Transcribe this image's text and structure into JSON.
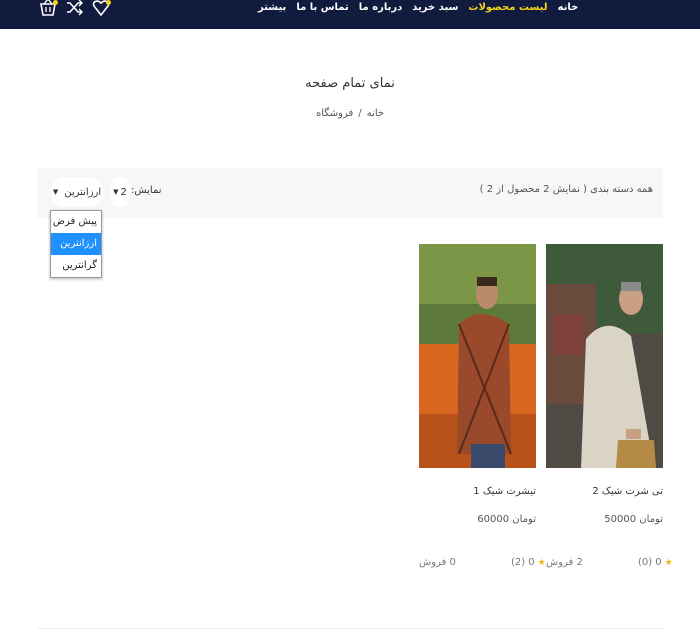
{
  "header": {
    "nav": [
      "خانه",
      "لیست محصولات",
      "سبد خرید",
      "درباره ما",
      "تماس با ما",
      "بیشتر"
    ],
    "active_index": 1,
    "bg_color": "#101b3d",
    "accent_color": "#f3d31b",
    "icons": [
      "basket-icon",
      "shuffle-icon",
      "heart-icon"
    ]
  },
  "page": {
    "title": "نمای تمام صفحه",
    "breadcrumb": [
      "خانه",
      "/",
      "فروشگاه"
    ]
  },
  "toolbar": {
    "result_text": "همه دسته بندی ( نمایش 2 محصول از 2 )",
    "show_label": "نمایش:",
    "show_value": "2",
    "sort_value": "ارزانترین",
    "sort_options": [
      "پیش فرض",
      "ارزانترین",
      "گرانترین"
    ],
    "sort_selected_index": 1
  },
  "products": [
    {
      "name": "تی شرت شیک 2",
      "price": "50000 تومان",
      "rating_count": "(0)",
      "rating_value": "0",
      "sales": "2 فروش"
    },
    {
      "name": "تیشرت شیک 1",
      "price": "60000 تومان",
      "rating_count": "(2)",
      "rating_value": "0",
      "sales": "0 فروش"
    }
  ]
}
